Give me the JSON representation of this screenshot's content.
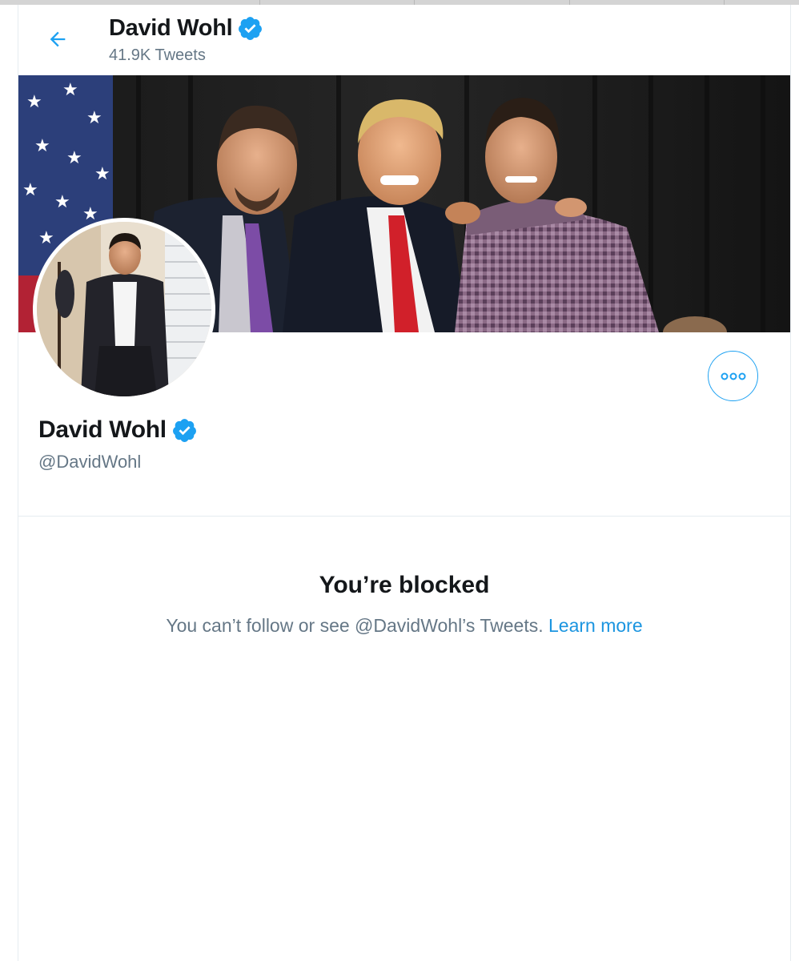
{
  "header": {
    "name": "David Wohl",
    "tweet_count": "41.9K Tweets"
  },
  "profile": {
    "name": "David Wohl",
    "handle": "@DavidWohl",
    "verified": true
  },
  "blocked": {
    "title": "You’re blocked",
    "message": "You can’t follow or see @DavidWohl’s Tweets.",
    "link_label": "Learn more"
  },
  "icons": {
    "back": "back-arrow-icon",
    "verified": "verified-badge-icon",
    "more": "more-options-icon"
  },
  "colors": {
    "accent": "#1da1f2",
    "link": "#1b95e0",
    "secondary_text": "#657786",
    "primary_text": "#14171a"
  }
}
